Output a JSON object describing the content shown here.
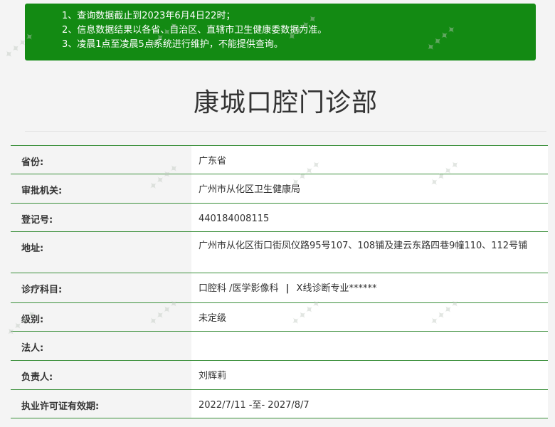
{
  "notice": {
    "lines": [
      "1、查询数据截止到2023年6月4日22时；",
      "2、信息数据结果以各省、自治区、直辖市卫生健康委数据为准。",
      "3、凌晨1点至凌晨5点系统进行维护，不能提供查询。"
    ]
  },
  "title": "康城口腔门诊部",
  "rows": [
    {
      "label": "省份:",
      "value": "广东省"
    },
    {
      "label": "审批机关:",
      "value": "广州市从化区卫生健康局"
    },
    {
      "label": "登记号:",
      "value": "440184008115"
    },
    {
      "label": "地址:",
      "value": "广州市从化区街口街凤仪路95号107、108铺及建云东路四巷9幢110、112号铺"
    },
    {
      "label": "诊疗科目:",
      "value_parts": [
        "口腔科 /医学影像科",
        "|",
        "X线诊断专业******"
      ]
    },
    {
      "label": "级别:",
      "value": "未定级"
    },
    {
      "label": "法人:",
      "value": ""
    },
    {
      "label": "负责人:",
      "value": "刘辉莉"
    },
    {
      "label": "执业许可证有效期:",
      "value": "2022/7/11 -至- 2027/8/7"
    }
  ],
  "colors": {
    "notice_bg": "#138a13",
    "row_border": "#3a8f3a"
  }
}
